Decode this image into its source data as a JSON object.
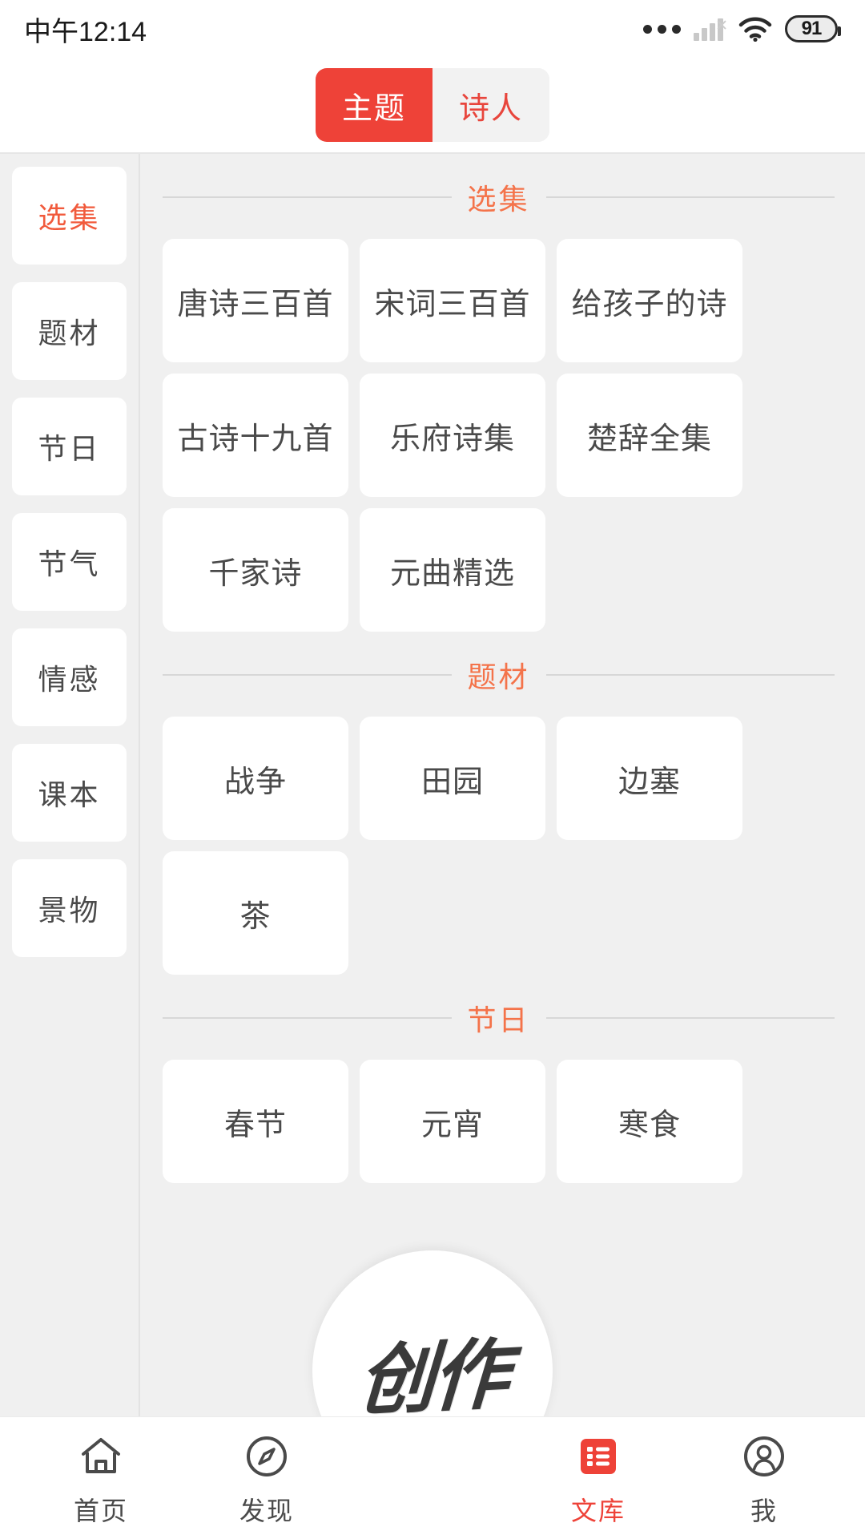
{
  "status_bar": {
    "time": "中午12:14",
    "battery_level": "91",
    "icons": [
      "more-dots-icon",
      "signal-no-service-icon",
      "wifi-icon",
      "battery-icon"
    ]
  },
  "top_tabs": {
    "items": [
      {
        "label": "主题",
        "active": true
      },
      {
        "label": "诗人",
        "active": false
      }
    ],
    "active_color": "#ee4238",
    "inactive_bg": "#f2f2f2"
  },
  "sidebar": {
    "items": [
      {
        "label": "选集",
        "active": true
      },
      {
        "label": "题材",
        "active": false
      },
      {
        "label": "节日",
        "active": false
      },
      {
        "label": "节气",
        "active": false
      },
      {
        "label": "情感",
        "active": false
      },
      {
        "label": "课本",
        "active": false
      },
      {
        "label": "景物",
        "active": false
      }
    ],
    "active_color": "#f15a3c"
  },
  "main": {
    "section_title_color": "#f4734a",
    "sections": [
      {
        "title": "选集",
        "items": [
          "唐诗三百首",
          "宋词三百首",
          "给孩子的诗",
          "古诗十九首",
          "乐府诗集",
          "楚辞全集",
          "千家诗",
          "元曲精选"
        ]
      },
      {
        "title": "题材",
        "items": [
          "战争",
          "田园",
          "边塞",
          "茶"
        ]
      },
      {
        "title": "节日",
        "items": [
          "春节",
          "元宵",
          "寒食"
        ]
      }
    ]
  },
  "fab": {
    "label": "创作"
  },
  "bottom_nav": {
    "items": [
      {
        "label": "首页",
        "icon": "home-icon",
        "active": false
      },
      {
        "label": "发现",
        "icon": "compass-icon",
        "active": false
      },
      {
        "label": "文库",
        "icon": "library-list-icon",
        "active": true
      },
      {
        "label": "我",
        "icon": "user-profile-icon",
        "active": false
      }
    ],
    "active_color": "#ee4238"
  }
}
